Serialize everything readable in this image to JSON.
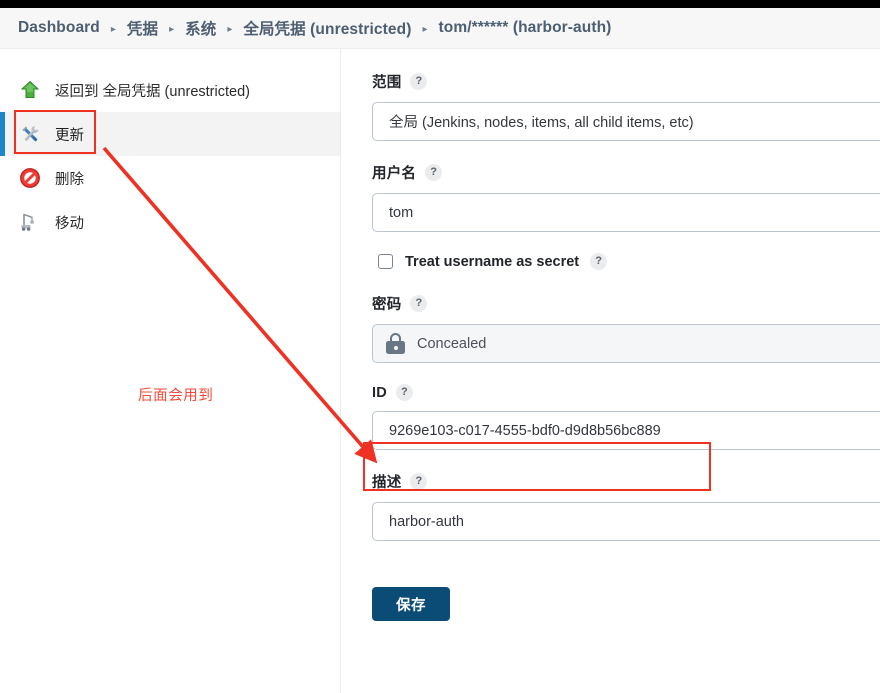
{
  "breadcrumb": {
    "separator_icon": "chevron-right-icon",
    "items": [
      {
        "label": "Dashboard"
      },
      {
        "label": "凭据"
      },
      {
        "label": "系统"
      },
      {
        "label": "全局凭据 (unrestricted)"
      },
      {
        "label": "tom/****** (harbor-auth)"
      }
    ]
  },
  "sidebar": {
    "items": [
      {
        "label": "返回到 全局凭据 (unrestricted)",
        "icon": "up-arrow-icon",
        "active": false
      },
      {
        "label": "更新",
        "icon": "wrench-screwdriver-icon",
        "active": true
      },
      {
        "label": "删除",
        "icon": "no-entry-icon",
        "active": false
      },
      {
        "label": "移动",
        "icon": "crane-icon",
        "active": false
      }
    ]
  },
  "annotation": {
    "note_text": "后面会用到",
    "note_color": "#f4483a",
    "highlight_color": "#ef3124"
  },
  "form": {
    "help_badge": "?",
    "scope": {
      "label": "范围",
      "value": "全局 (Jenkins, nodes, items, all child items, etc)",
      "value_prefix": "全局",
      "value_suffix": "(Jenkins, nodes, items, all child items, etc)"
    },
    "username": {
      "label": "用户名",
      "value": "tom",
      "placeholder": ""
    },
    "treat_secret": {
      "label": "Treat username as secret",
      "checked": false
    },
    "password": {
      "label": "密码",
      "value": "Concealed",
      "icon": "lock-icon"
    },
    "id": {
      "label": "ID",
      "value": "9269e103-c017-4555-bdf0-d9d8b56bc889",
      "placeholder": ""
    },
    "description": {
      "label": "描述",
      "value": "harbor-auth",
      "placeholder": ""
    },
    "save_label": "保存",
    "save_color": "#0b4c76"
  }
}
